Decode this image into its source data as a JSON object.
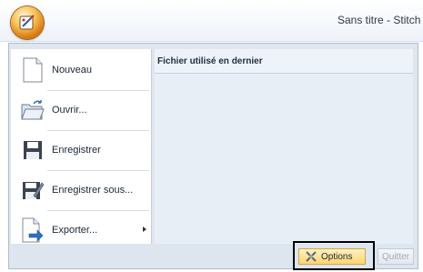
{
  "window": {
    "title": "Sans titre - Stitch D"
  },
  "menu": {
    "items": [
      {
        "label": "Nouveau",
        "icon": "new-document-icon"
      },
      {
        "label": "Ouvrir...",
        "icon": "open-folder-icon"
      },
      {
        "label": "Enregistrer",
        "icon": "save-icon"
      },
      {
        "label": "Enregistrer sous...",
        "icon": "save-as-icon"
      },
      {
        "label": "Exporter...",
        "icon": "export-icon",
        "has_submenu": true
      }
    ],
    "recent_header": "Fichier utilisé en dernier"
  },
  "footer": {
    "options_label": "Options",
    "quit_label": "Quitter"
  },
  "colors": {
    "accent": "#ffd670",
    "panel": "#dfe6ef"
  }
}
